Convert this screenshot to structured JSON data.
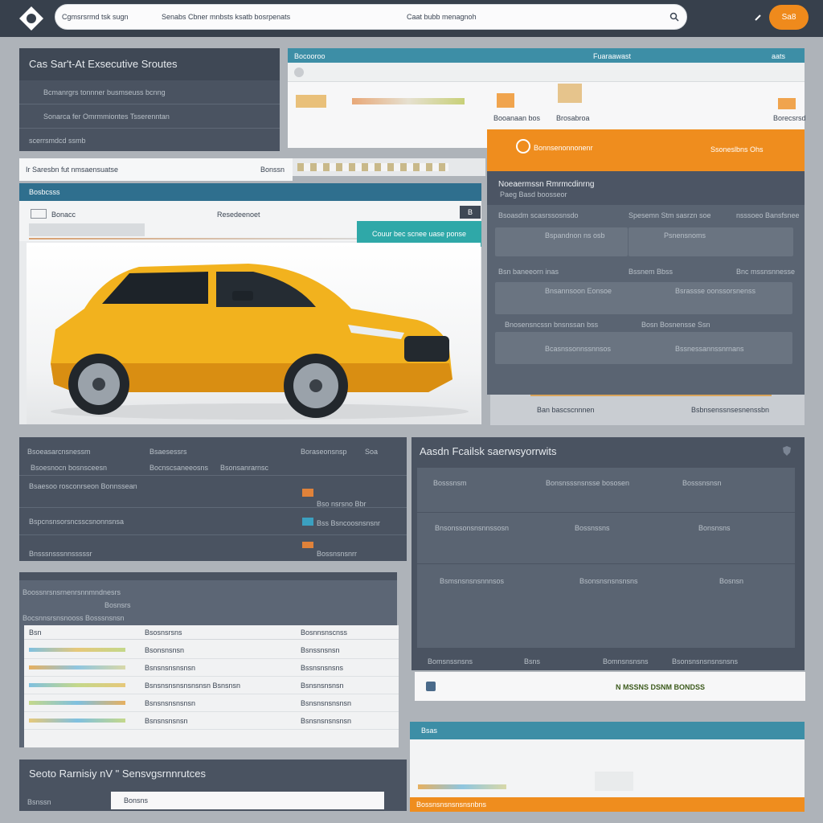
{
  "header": {
    "search_left": "Cgmsrsrmd tsk sugn",
    "search_mid": "Senabs Cbner mnbsts ksatb bosrpenats",
    "search_right": "Caat bubb menagnoh",
    "cta_label": "Sa8"
  },
  "service_card": {
    "title": "Cas Sar't-At Exsecutive Sroutes",
    "rows": [
      "Bcmanrgrs tonnner busmseuss bcnng",
      "Sonarca fer Omrmmiontes Tsserenntan",
      "scerrsmdcd ssmb"
    ]
  },
  "filter_bar": {
    "left": "Ir Saresbn fut nmsaensuatse",
    "btn": "Bonssn"
  },
  "top_table": {
    "header_left": "Bocooroo",
    "header_mid": "Fuaraawast",
    "header_right": "aats",
    "cols": [
      "Booanaan bos",
      "Brosabroa",
      "Borecsrsd"
    ]
  },
  "vehicle_view": {
    "header": "Bosbcsss",
    "tab_label": "Bonacc",
    "tab_right": "Resedeenoet",
    "tag": "B",
    "button": "Couur bec scnee uase ponse"
  },
  "orange_banner": {
    "title": "Bonnsenonnonenr",
    "right": "Ssoneslbns Ohs"
  },
  "booking_panel": {
    "title": "Noeaermssn Rmrmcdinrng",
    "subtitle": "Paeg Basd boosseor",
    "sections": [
      {
        "label": "Bsoasdm scasrssosnsdo",
        "cols": [
          "Spesemn Stm sasrzn soe",
          "nsssoeo Bansfsnee"
        ],
        "rows": [
          "Bspandnon ns osb",
          "Psnensnoms"
        ]
      },
      {
        "label": "Bsn baneeorn inas",
        "cols": [
          "Bssnem Bbss",
          "Bnc mssnsnnesse"
        ],
        "rows": [
          "Bnsannsoon Eonsoe",
          "Bsrassse oonssorsnenss"
        ]
      },
      {
        "label": "Bnosensncssn bnsnssan bss",
        "cols": [
          "Bosn Bosnensse Ssn"
        ],
        "rows": [
          "Bcasnssonnssnnsos",
          "Bssnessannssnrnans"
        ]
      }
    ],
    "footer_left": "Ban bascscnnnen",
    "footer_right": "Bsbnsenssnsesnenssbn"
  },
  "list_panel": {
    "headers": [
      "Bsoeasarcnsnessm",
      "Bsaesessrs",
      "Boraseonsnsp",
      "Soa"
    ],
    "rows": [
      [
        "Bsoesnocn bosnsceesn",
        "Bocnscsaneeosns",
        "Bsonsanrarnsc"
      ],
      [
        "Bsaesoo rosconrseon Bonnssean",
        "",
        "Bso nsrsno Bbr"
      ],
      [
        "Bspcnsnsorsncsscsnonnsnsa",
        "",
        "Bss Bsncoosnsnsnr"
      ],
      [
        "Bnsssnsssnnsssssr",
        "",
        "Bossnsnsnrr"
      ]
    ]
  },
  "data_table": {
    "title": "Boossnrsnsrnenrsnnmndnesrs",
    "sub": "Bosnsrs",
    "sub2": "Bocsnnsrsnsnooss Bosssnsnsn",
    "columns": [
      "Bsn",
      "Bsosnsrsns",
      "Bosnnsnscnss"
    ],
    "rows": [
      [
        "Bonsnscnsn",
        "Bsonsnsnsn",
        "Bsnssnsnsn"
      ],
      [
        "Bsonsnssnsn",
        "Bsnsnsnsnsnsn",
        "Bssnsnsnsns"
      ],
      [
        "Bsnsnsn",
        "Bsnsnsnsnsnsnsnsn Bsnsnsn",
        "Bsnsnsnsnsn"
      ],
      [
        "Bsnsnsns",
        "Bsnsnsnsnsnsn",
        "Bsnsnsnsnsnsn"
      ],
      [
        "Bsnsnsnsns",
        "Bsnsnsnsnsn",
        "Bsnsnsnsnsnsn"
      ]
    ]
  },
  "feature_panel": {
    "title": "Aasdn Fcailsk saerwsyorrwits",
    "blocks": [
      {
        "a": "Bosssnsm",
        "b": "Bonsnsssnsnsse bososen",
        "c": "Bosssnsnsn"
      },
      {
        "a": "Bnsonssonsnsnnssosn",
        "b": "Bossnssns",
        "c": "Bonsnsns"
      },
      {
        "a": "Bsmsnsnsnsnnnsos",
        "b": "Bsonsnsnsnsnsns",
        "c": "Bosnsn"
      }
    ],
    "footer": [
      "Bomsnssnsns",
      "Bsns",
      "Bomnsnsnsns",
      "Bsonsnsnsnsnsnsns"
    ],
    "bottom_label": "N MSSNS DSNM BONDSS"
  },
  "bottom_left": {
    "title": "Seoto Rarnisiy nV \" Sensvgsrnnrutces",
    "label": "Bsnssn",
    "input": "Bonsns"
  },
  "bottom_right": {
    "header": "Bsas",
    "footer": "Bossnsnsnsnsnsnbns"
  },
  "colors": {
    "accent": "#ef8d1e",
    "teal": "#3d8ea6",
    "dark": "#37404c"
  }
}
